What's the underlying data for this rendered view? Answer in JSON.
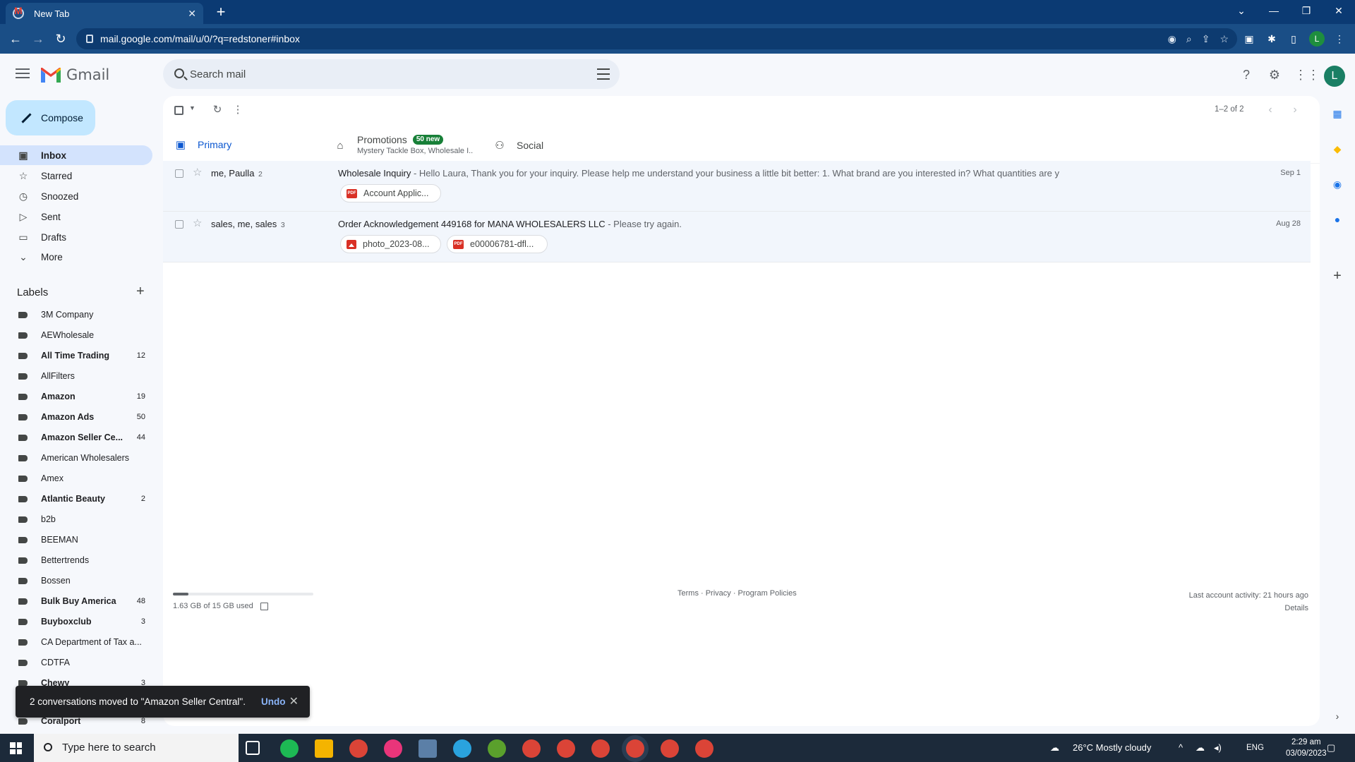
{
  "browser": {
    "tab_title": "New Tab",
    "url": "mail.google.com/mail/u/0/?q=redstoner#inbox",
    "profile_initial": "L"
  },
  "header": {
    "app_name": "Gmail",
    "search_placeholder": "Search mail",
    "avatar_initial": "L"
  },
  "nav": {
    "compose_label": "Compose",
    "items": [
      {
        "label": "Inbox",
        "icon": "inbox-icon"
      },
      {
        "label": "Starred",
        "icon": "star-icon"
      },
      {
        "label": "Snoozed",
        "icon": "clock-icon"
      },
      {
        "label": "Sent",
        "icon": "send-icon"
      },
      {
        "label": "Drafts",
        "icon": "draft-icon"
      },
      {
        "label": "More",
        "icon": "chevron-down-icon"
      }
    ],
    "labels_title": "Labels",
    "labels": [
      {
        "name": "3M Company",
        "count": ""
      },
      {
        "name": "AEWholesale",
        "count": ""
      },
      {
        "name": "All Time Trading",
        "count": "12"
      },
      {
        "name": "AllFilters",
        "count": ""
      },
      {
        "name": "Amazon",
        "count": "19"
      },
      {
        "name": "Amazon Ads",
        "count": "50"
      },
      {
        "name": "Amazon Seller Ce...",
        "count": "44"
      },
      {
        "name": "American Wholesalers",
        "count": ""
      },
      {
        "name": "Amex",
        "count": ""
      },
      {
        "name": "Atlantic Beauty",
        "count": "2"
      },
      {
        "name": "b2b",
        "count": ""
      },
      {
        "name": "BEEMAN",
        "count": ""
      },
      {
        "name": "Bettertrends",
        "count": ""
      },
      {
        "name": "Bossen",
        "count": ""
      },
      {
        "name": "Bulk Buy America",
        "count": "48"
      },
      {
        "name": "Buyboxclub",
        "count": "3"
      },
      {
        "name": "CA Department of Tax a...",
        "count": ""
      },
      {
        "name": "CDTFA",
        "count": ""
      },
      {
        "name": "Chewy",
        "count": "3"
      },
      {
        "name": "Coralport",
        "count": "8"
      }
    ]
  },
  "toolbar": {
    "page_count": "1–2 of 2"
  },
  "tabs": {
    "primary": "Primary",
    "promotions": "Promotions",
    "promotions_badge": "50 new",
    "promotions_snippet": "Mystery Tackle Box, Wholesale I...",
    "social": "Social"
  },
  "emails": [
    {
      "sender": "me, Paulla",
      "count": "2",
      "subject": "Wholesale Inquiry",
      "snippet": " - Hello Laura, Thank you for your inquiry. Please help me understand your business a little bit better: 1. What brand are you interested in? What quantities are y",
      "date": "Sep 1",
      "attachments": [
        {
          "name": "Account Applic...",
          "type": "pdf"
        }
      ]
    },
    {
      "sender": "sales, me, sales",
      "count": "3",
      "subject": "Order Acknowledgement 449168 for MANA WHOLESALERS LLC",
      "snippet": " - Please try again.",
      "date": "Aug 28",
      "attachments": [
        {
          "name": "photo_2023-08...",
          "type": "image"
        },
        {
          "name": "e00006781-dfl...",
          "type": "pdf"
        }
      ]
    }
  ],
  "footer": {
    "storage_text": "1.63 GB of 15 GB used",
    "storage_used_fraction": 0.109,
    "links": "Terms · Privacy · Program Policies",
    "activity": "Last account activity: 21 hours ago",
    "details": "Details"
  },
  "toast": {
    "message": "2 conversations moved to \"Amazon Seller Central\".",
    "undo": "Undo"
  },
  "taskbar": {
    "search_placeholder": "Type here to search",
    "weather": "26°C  Mostly cloudy",
    "lang": "ENG",
    "time": "2:29 am",
    "date": "03/09/2023"
  }
}
